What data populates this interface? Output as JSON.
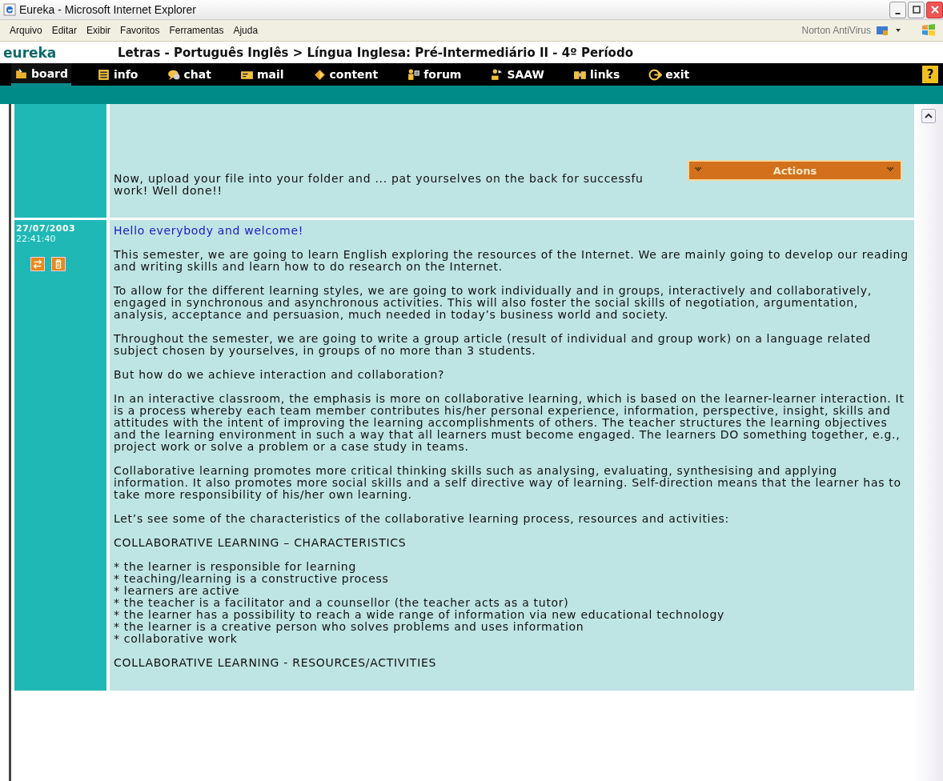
{
  "window": {
    "title": "Eureka - Microsoft Internet Explorer"
  },
  "menu": [
    "Arquivo",
    "Editar",
    "Exibir",
    "Favoritos",
    "Ferramentas",
    "Ajuda"
  ],
  "toolbar_plugin": "Norton AntiVirus",
  "header": {
    "logo": "eureka",
    "breadcrumb": "Letras - Português Inglês > Língua Inglesa: Pré-Intermediário II - 4º Período"
  },
  "nav": [
    {
      "label": "board",
      "kind": "board",
      "selected": true
    },
    {
      "label": "info",
      "kind": "info",
      "selected": false
    },
    {
      "label": "chat",
      "kind": "chat",
      "selected": false
    },
    {
      "label": "mail",
      "kind": "mail",
      "selected": false
    },
    {
      "label": "content",
      "kind": "content",
      "selected": false
    },
    {
      "label": "forum",
      "kind": "forum",
      "selected": false
    },
    {
      "label": "SAAW",
      "kind": "saaw",
      "selected": false
    },
    {
      "label": "links",
      "kind": "links",
      "selected": false
    },
    {
      "label": "exit",
      "kind": "exit",
      "selected": false
    },
    {
      "label": "?",
      "kind": "help"
    }
  ],
  "actions_menu": {
    "label": "Actions"
  },
  "posts": [
    {
      "lines": [
        "Now, upload your file into your folder and ... pat yourselves on the back for successfu",
        "work! Well done!!"
      ]
    },
    {
      "date": "27/07/2003",
      "time": "22:41:40",
      "title": "Hello everybody and welcome!",
      "lines": [
        "This semester, we are going to learn English exploring the resources of the Internet. We are mainly going to develop our reading and writing skills and learn how to do research on the Internet.",
        "To allow for the different learning styles, we are going to work individually and in groups, interactively and collaboratively, engaged in synchronous and asynchronous activities. This will also foster the social skills of negotiation, argumentation, analysis, acceptance and persuasion, much needed in today’s business world and society.",
        "Throughout the semester, we are going to write a group article (result of individual and group work) on a language related subject chosen by yourselves, in groups of no more than 3 students.",
        "But how do we achieve interaction and collaboration?",
        "In an interactive classroom, the emphasis is more on collaborative learning, which is based on the learner-learner interaction. It is a process whereby each team member contributes his/her personal experience, information, perspective, insight, skills and attitudes with the intent of improving the learning accomplishments of others. The teacher structures the learning objectives and the learning environment in such a way that all learners must become engaged. The learners DO something together, e.g., project work or solve a problem or a case study in teams.",
        "Collaborative learning promotes more critical thinking skills such as analysing, evaluating, synthesising and applying information. It also promotes more social skills and a self directive way of learning. Self-direction means that the learner has to take more responsibility of his/her own learning.",
        "Let’s see some of the characteristics of the collaborative learning process, resources and activities:",
        "COLLABORATIVE LEARNING – CHARACTERISTICS",
        [
          "* the learner is responsible for learning",
          "* teaching/learning is a constructive process",
          "* learners are active",
          "* the teacher is a facilitator and a counsellor (the teacher acts as a tutor)",
          "* the learner has a possibility to reach a wide range of information via new educational technology",
          "* the learner is a creative person who solves problems and uses information",
          "* collaborative work"
        ],
        "COLLABORATIVE LEARNING - RESOURCES/ACTIVITIES"
      ]
    }
  ]
}
